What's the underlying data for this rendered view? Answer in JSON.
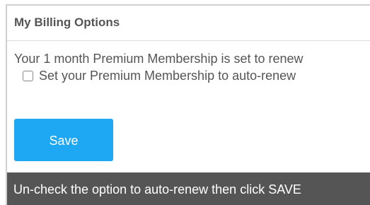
{
  "header": {
    "title": "My Billing Options"
  },
  "billing": {
    "renew_status": "Your 1 month Premium Membership is set to renew",
    "auto_renew": {
      "label": "Set your Premium Membership to auto-renew",
      "checked": false
    },
    "save_label": "Save"
  },
  "instruction": {
    "text": "Un-check the option to auto-renew then click SAVE"
  },
  "colors": {
    "primary_button": "#1ea7f2",
    "instruction_bar": "#555555",
    "text": "#555555"
  }
}
